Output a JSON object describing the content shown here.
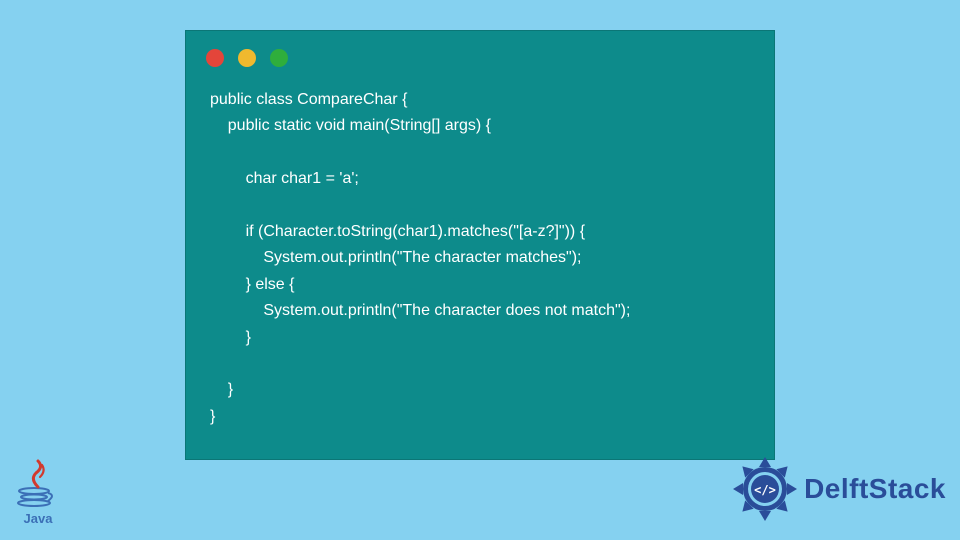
{
  "window": {
    "dots": {
      "red": "#e4453a",
      "yellow": "#f0b92e",
      "green": "#2fae3c"
    }
  },
  "code": {
    "lines": [
      "public class CompareChar {",
      "    public static void main(String[] args) {",
      "",
      "        char char1 = 'a';",
      "",
      "        if (Character.toString(char1).matches(\"[a-z?]\")) {",
      "            System.out.println(\"The character matches\");",
      "        } else {",
      "            System.out.println(\"The character does not match\");",
      "        }",
      "",
      "    }",
      "}"
    ]
  },
  "footer": {
    "java_label": "Java",
    "delft_label": "DelftStack"
  }
}
